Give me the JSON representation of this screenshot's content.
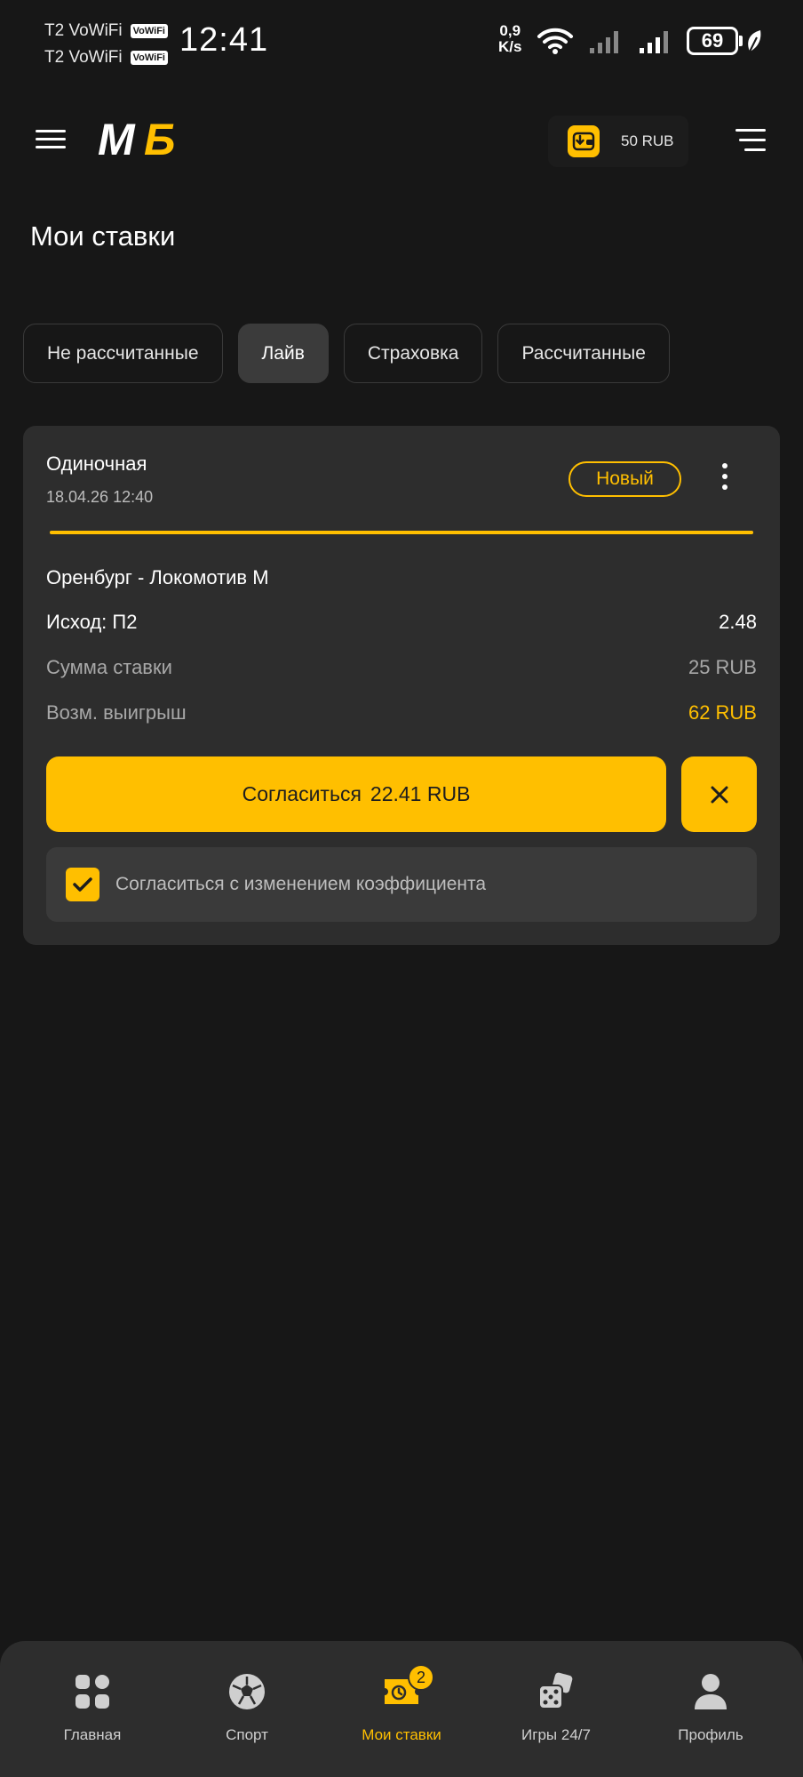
{
  "status_bar": {
    "carrier_1": "T2 VoWiFi",
    "carrier_2": "T2 VoWiFi",
    "vowifi_badge": "VoWiFi",
    "time": "12:41",
    "net_speed_value": "0,9",
    "net_speed_unit": "K/s",
    "battery": "69"
  },
  "header": {
    "logo_text": "МБ",
    "wallet_balance": "50 RUB"
  },
  "page": {
    "title": "Мои ставки"
  },
  "tabs": [
    {
      "label": "Не рассчитанные",
      "active": false
    },
    {
      "label": "Лайв",
      "active": true
    },
    {
      "label": "Страховка",
      "active": false
    },
    {
      "label": "Рассчитанные",
      "active": false
    }
  ],
  "bet": {
    "type": "Одиночная",
    "date": "18.04.26 12:40",
    "status": "Новый",
    "match": "Оренбург - Локомотив М",
    "outcome_label": "Исход: П2",
    "outcome_odds": "2.48",
    "stake_label": "Сумма ставки",
    "stake_value": "25 RUB",
    "win_label": "Возм. выигрыш",
    "win_value": "62 RUB",
    "accept_label": "Согласиться",
    "accept_amount": "22.41 RUB",
    "agree_text": "Согласиться с изменением коэффициента",
    "agree_checked": true,
    "progress": 1.0
  },
  "bottom_nav": [
    {
      "label": "Главная",
      "icon": "home-grid-icon"
    },
    {
      "label": "Спорт",
      "icon": "soccer-ball-icon"
    },
    {
      "label": "Мои ставки",
      "icon": "ticket-clock-icon",
      "badge": "2",
      "active": true
    },
    {
      "label": "Игры 24/7",
      "icon": "dice-icon"
    },
    {
      "label": "Профиль",
      "icon": "person-icon"
    }
  ],
  "colors": {
    "accent": "#ffbf00",
    "background": "#171717",
    "card": "#2d2d2d"
  }
}
